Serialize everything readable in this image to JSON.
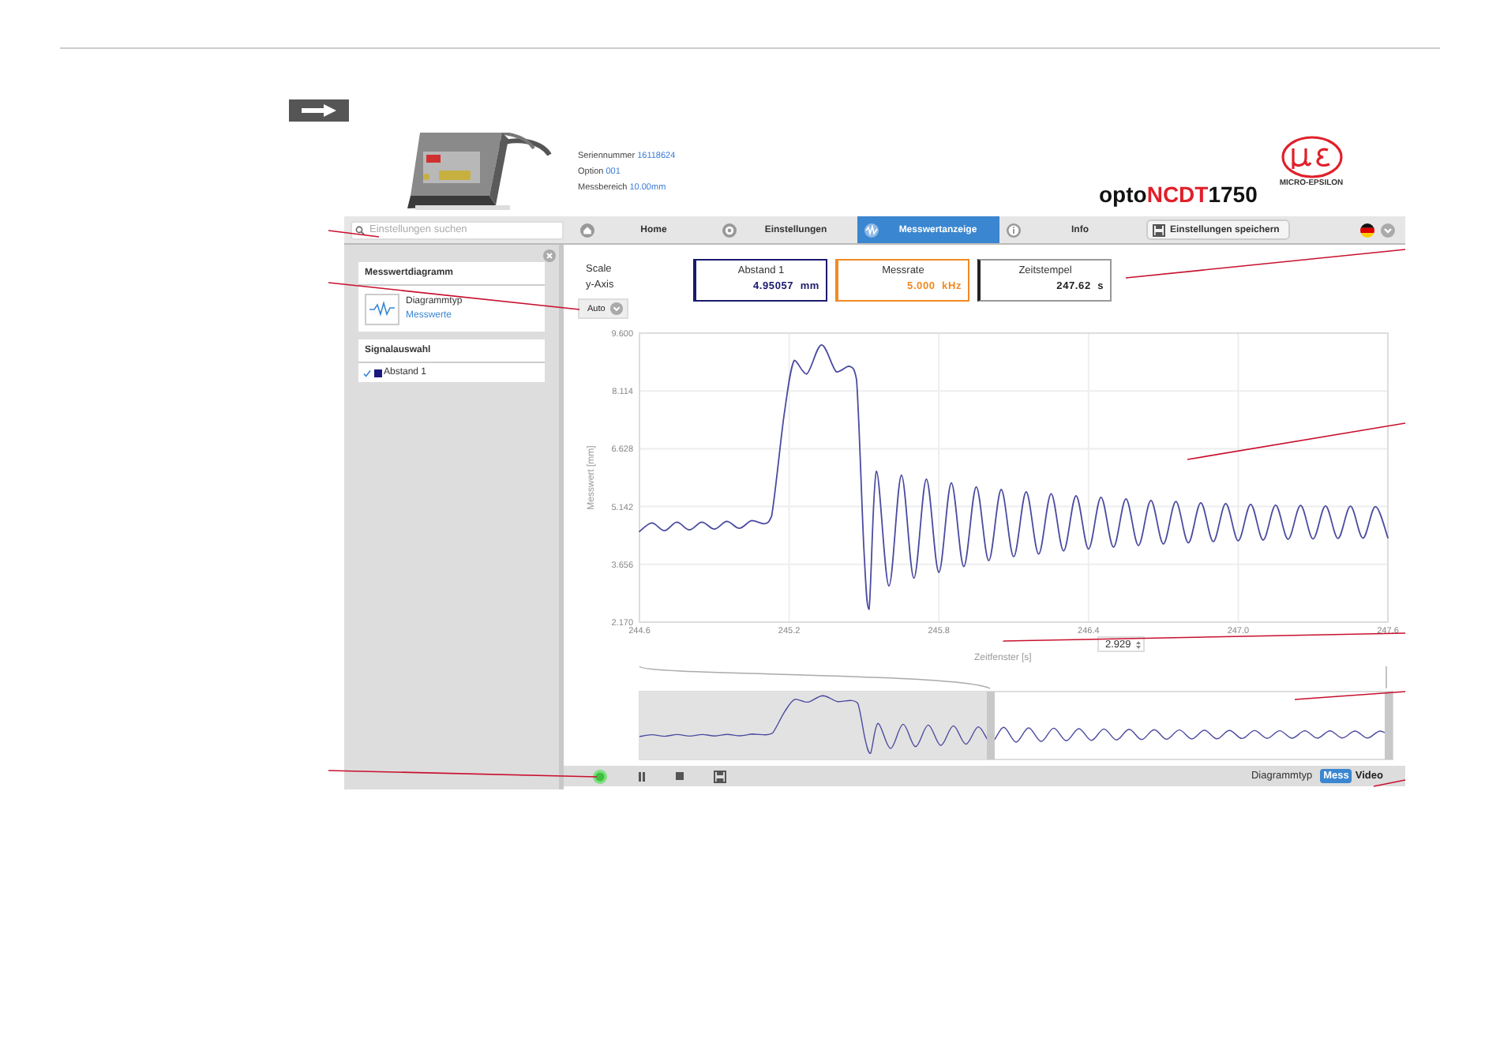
{
  "header": {
    "info": [
      {
        "label": "Seriennummer",
        "value": "16118624"
      },
      {
        "label": "Option",
        "value": "001"
      },
      {
        "label": "Messbereich",
        "value": "10.00mm"
      }
    ],
    "product_name": [
      "opto",
      "NCDT",
      "1750"
    ],
    "company": "MICRO-EPSILON"
  },
  "nav": {
    "search": {
      "placeholder": "Einstellungen suchen"
    },
    "tabs": [
      {
        "label": "Home",
        "kind": "home",
        "selected": false
      },
      {
        "label": "Einstellungen",
        "kind": "settings",
        "selected": false
      },
      {
        "label": "Messwertanzeige",
        "kind": "wave",
        "selected": true
      },
      {
        "label": "Info",
        "kind": "info",
        "selected": false
      }
    ],
    "save_button": "Einstellungen speichern"
  },
  "sidebar": {
    "sections": [
      {
        "title": "Messwertdiagramm",
        "items": [
          {
            "kind": "chart-type",
            "label": "Diagrammtyp",
            "value": "Messwerte"
          }
        ]
      },
      {
        "title": "Signalauswahl",
        "items": [
          {
            "kind": "signal",
            "label": "Abstand 1",
            "checked": true,
            "color": "#1a1a80"
          }
        ]
      }
    ]
  },
  "scale": {
    "label": [
      "Scale",
      "y-Axis"
    ],
    "value": "Auto"
  },
  "readouts": [
    {
      "label": "Abstand 1",
      "value": "4.95057",
      "unit": "mm",
      "color": "#1a1a6e"
    },
    {
      "label": "Messrate",
      "value": "5.000",
      "unit": "kHz",
      "color": "#f08a24"
    },
    {
      "label": "Zeitstempel",
      "value": "247.62",
      "unit": "s",
      "color": "#222222"
    }
  ],
  "chart": {
    "chart_data": {
      "type": "line",
      "xlabel": "Zeitfenster [s]",
      "ylabel": "Messwert [mm]",
      "xlim": [
        244.6,
        247.6
      ],
      "ylim": [
        2.17,
        9.6
      ],
      "xticks": [
        244.6,
        245.2,
        245.8,
        246.4,
        {
          "value": 247,
          "label": "247.0"
        },
        247.6
      ],
      "yticks": [
        {
          "value": 9.6,
          "label": "9.600"
        },
        {
          "value": 8.114,
          "label": "8.114"
        },
        {
          "value": 6.628,
          "label": "6.628"
        },
        {
          "value": 5.142,
          "label": "5.142"
        },
        {
          "value": 3.656,
          "label": "3.656"
        },
        {
          "value": 2.17,
          "label": "2.170"
        }
      ],
      "x": [
        244.6,
        244.65,
        244.7,
        244.75,
        244.8,
        244.85,
        244.9,
        244.95,
        245.0,
        245.05,
        245.1,
        245.13,
        245.18,
        245.22,
        245.27,
        245.33,
        245.39,
        245.44,
        245.47,
        245.5,
        245.52,
        245.55,
        245.6,
        245.65,
        245.7,
        245.75,
        245.8,
        245.85,
        245.9,
        245.95,
        246.0,
        246.05,
        246.1,
        246.15,
        246.2,
        246.25,
        246.3,
        246.35,
        246.4,
        246.45,
        246.5,
        246.55,
        246.6,
        246.65,
        246.7,
        246.75,
        246.8,
        246.85,
        246.9,
        246.95,
        247.0,
        247.05,
        247.1,
        247.15,
        247.2,
        247.25,
        247.3,
        247.35,
        247.4,
        247.45,
        247.5,
        247.55,
        247.6
      ],
      "grid": true,
      "series": [
        {
          "color": "#4b4ba0",
          "values": [
            4.5,
            4.72,
            4.52,
            4.74,
            4.54,
            4.74,
            4.56,
            4.76,
            4.58,
            4.78,
            4.7,
            4.9,
            7.5,
            8.9,
            8.55,
            9.3,
            8.6,
            8.75,
            8.4,
            4.0,
            2.5,
            6.05,
            3.1,
            5.95,
            3.3,
            5.85,
            3.45,
            5.75,
            3.6,
            5.65,
            3.75,
            5.58,
            3.85,
            5.52,
            3.92,
            5.47,
            4.0,
            5.42,
            4.05,
            5.38,
            4.1,
            5.34,
            4.14,
            5.3,
            4.18,
            5.27,
            4.21,
            5.24,
            4.24,
            5.22,
            4.26,
            5.2,
            4.28,
            5.18,
            4.3,
            5.17,
            4.31,
            5.16,
            4.32,
            5.15,
            4.33,
            5.14,
            4.34
          ]
        }
      ]
    },
    "time_window": "2.929"
  },
  "toolbar": {
    "controls": [
      {
        "kind": "run"
      },
      {
        "kind": "pause"
      },
      {
        "kind": "stop"
      },
      {
        "kind": "save"
      }
    ],
    "diagram_type": {
      "label": "Diagrammtyp",
      "options": [
        {
          "label": "Mess",
          "selected": true
        },
        {
          "label": "Video",
          "selected": false
        }
      ]
    }
  }
}
